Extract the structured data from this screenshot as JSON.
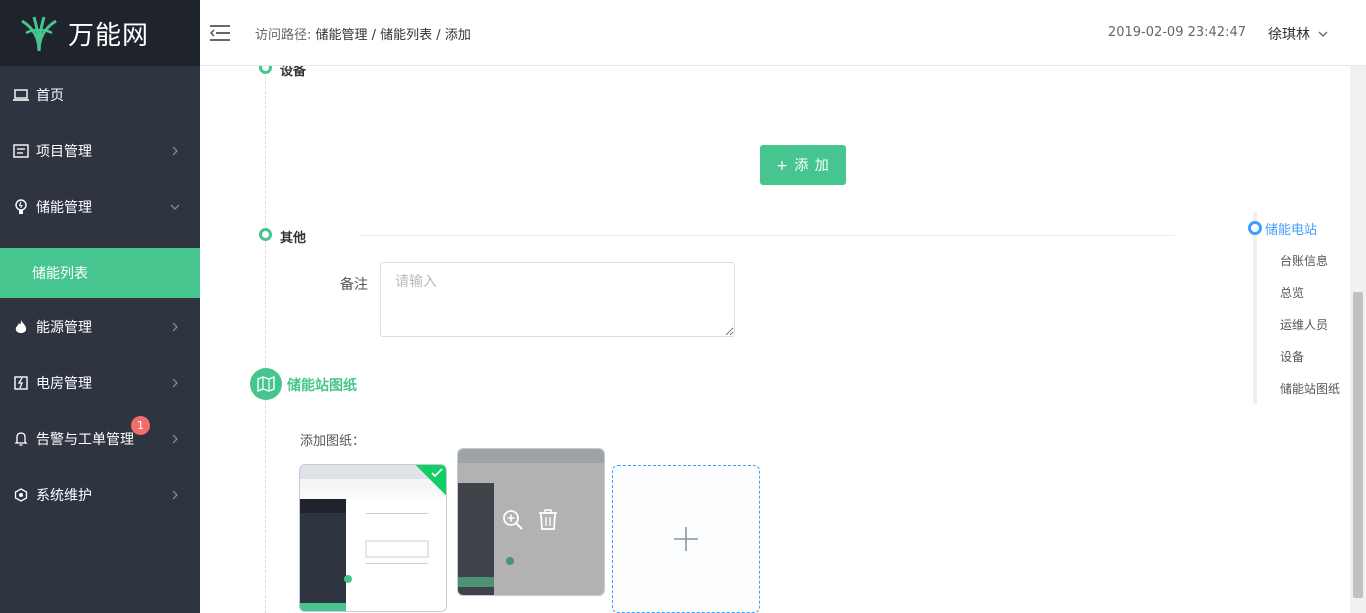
{
  "sidebar": {
    "logo_text": "万能网",
    "items": [
      {
        "label": "首页",
        "icon": "laptop-icon"
      },
      {
        "label": "项目管理",
        "icon": "project-icon"
      },
      {
        "label": "储能管理",
        "icon": "energy-storage-icon"
      },
      {
        "label": "储能列表",
        "icon": ""
      },
      {
        "label": "能源管理",
        "icon": "flame-icon"
      },
      {
        "label": "电房管理",
        "icon": "power-room-icon"
      },
      {
        "label": "告警与工单管理",
        "icon": "bell-icon"
      },
      {
        "label": "系统维护",
        "icon": "system-icon"
      }
    ],
    "badge": "1"
  },
  "header": {
    "breadcrumb_label": "访问路径:",
    "breadcrumb_path": "储能管理 / 储能列表 / 添加",
    "datetime": "2019-02-09 23:42:47",
    "username": "徐琪林"
  },
  "content": {
    "section_device": "设备",
    "add_button": "+ 添 加",
    "section_other": "其他",
    "remark_label": "备注",
    "remark_placeholder": "请输入",
    "drawing_section_title": "储能站图纸",
    "add_drawing_label": "添加图纸："
  },
  "anchor_nav": {
    "items": [
      "储能电站",
      "台账信息",
      "总览",
      "运维人员",
      "设备",
      "储能站图纸"
    ]
  },
  "colors": {
    "accent": "#47c58f",
    "sidebar_bg": "#2e3440",
    "link_blue": "#409eff",
    "badge_red": "#f56c6c"
  }
}
